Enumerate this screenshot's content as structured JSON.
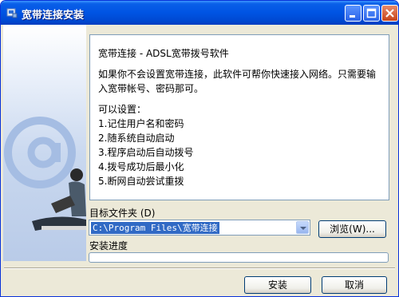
{
  "window": {
    "title": "宽带连接安装"
  },
  "info": {
    "heading": "宽带连接  - ADSL宽带拨号软件",
    "description": "如果你不会设置宽带连接，此软件可帮你快速接入网络。只需要输入宽带帐号、密码那可。",
    "features_title": "可以设置：",
    "features": [
      "1.记住用户名和密码",
      "2.随系统自动启动",
      "3.程序启动后自动拨号",
      "4.拨号成功后最小化",
      "5.断网自动尝试重拨"
    ]
  },
  "folder": {
    "label": "目标文件夹 (D)",
    "value": "C:\\Program Files\\宽带连接"
  },
  "buttons": {
    "browse": "浏览(W)...",
    "install": "安装",
    "cancel": "取消"
  },
  "progress": {
    "label": "安装进度",
    "value": 0
  },
  "colors": {
    "titlebar": "#0054e3",
    "window_bg": "#ece9d8",
    "selection": "#316ac5"
  },
  "icons": [
    "setup-icon",
    "minimize-icon",
    "maximize-icon",
    "close-icon",
    "dropdown-arrow-icon",
    "at-sign-icon"
  ]
}
